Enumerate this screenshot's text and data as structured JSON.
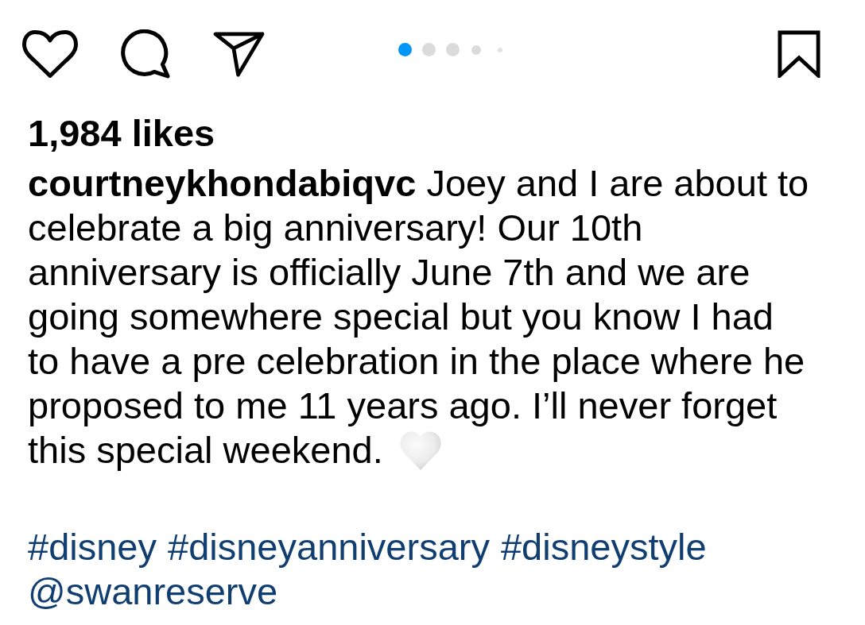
{
  "post": {
    "liked": false,
    "saved": false
  },
  "carousel": {
    "dots": [
      {
        "kind": "large",
        "selected": true
      },
      {
        "kind": "large",
        "selected": false
      },
      {
        "kind": "large",
        "selected": false
      },
      {
        "kind": "medium",
        "selected": false
      },
      {
        "kind": "small",
        "selected": false
      }
    ]
  },
  "likes": "1,984 likes",
  "caption": "**courtneykhondabiqvc** Joey and I are about to celebrate a big anniversary! Our 10th anniversary is officially June 7th and we are going somewhere special but you know I had to have a pre celebration in the place where he proposed to me 11 years ago. I’ll never forget this special weekend.",
  "tags": [
    "#disney",
    "#disneyanniversary",
    "#disneystyle",
    "@swanreserve"
  ]
}
